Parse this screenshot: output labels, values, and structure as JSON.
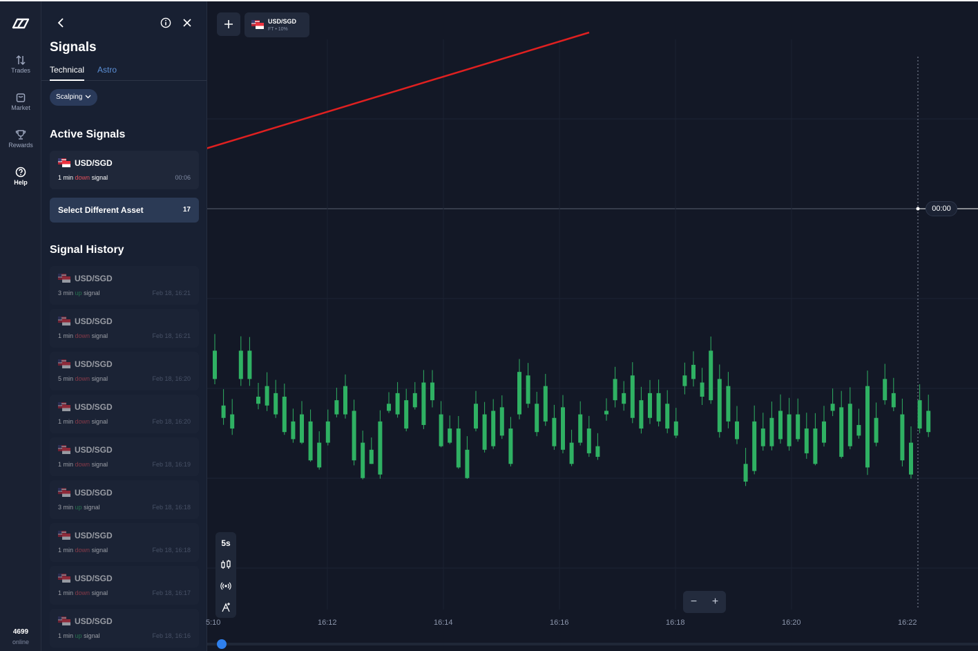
{
  "rail": {
    "items": [
      {
        "label": "Trades",
        "icon": "arrows-updown-icon"
      },
      {
        "label": "Market",
        "icon": "bag-icon"
      },
      {
        "label": "Rewards",
        "icon": "trophy-icon"
      },
      {
        "label": "Help",
        "icon": "question-icon"
      }
    ],
    "online_count": "4699",
    "online_label": "online"
  },
  "panel": {
    "title": "Signals",
    "tabs": [
      "Technical",
      "Astro"
    ],
    "filter": "Scalping",
    "active_heading": "Active Signals",
    "active_signal": {
      "symbol": "USD/SGD",
      "duration": "1 min",
      "direction": "down",
      "word": "signal",
      "timer": "00:06"
    },
    "select_button": {
      "label": "Select Different Asset",
      "count": "17"
    },
    "history_heading": "Signal History",
    "history": [
      {
        "symbol": "USD/SGD",
        "duration": "3 min",
        "direction": "up",
        "word": "signal",
        "time": "Feb 18, 16:21"
      },
      {
        "symbol": "USD/SGD",
        "duration": "1 min",
        "direction": "down",
        "word": "signal",
        "time": "Feb 18, 16:21"
      },
      {
        "symbol": "USD/SGD",
        "duration": "5 min",
        "direction": "down",
        "word": "signal",
        "time": "Feb 18, 16:20"
      },
      {
        "symbol": "USD/SGD",
        "duration": "1 min",
        "direction": "down",
        "word": "signal",
        "time": "Feb 18, 16:20"
      },
      {
        "symbol": "USD/SGD",
        "duration": "1 min",
        "direction": "down",
        "word": "signal",
        "time": "Feb 18, 16:19"
      },
      {
        "symbol": "USD/SGD",
        "duration": "3 min",
        "direction": "up",
        "word": "signal",
        "time": "Feb 18, 16:18"
      },
      {
        "symbol": "USD/SGD",
        "duration": "1 min",
        "direction": "down",
        "word": "signal",
        "time": "Feb 18, 16:18"
      },
      {
        "symbol": "USD/SGD",
        "duration": "1 min",
        "direction": "down",
        "word": "signal",
        "time": "Feb 18, 16:17"
      },
      {
        "symbol": "USD/SGD",
        "duration": "1 min",
        "direction": "up",
        "word": "signal",
        "time": "Feb 18, 16:16"
      }
    ]
  },
  "chart": {
    "asset_tab": {
      "symbol": "USD/SGD",
      "meta": "FT • 10%"
    },
    "timeframe": "5s",
    "price_tag": "00:00",
    "xticks": [
      "5:10",
      "16:12",
      "16:14",
      "16:16",
      "16:18",
      "16:20",
      "16:22"
    ],
    "colors": {
      "up": "#2fb163",
      "down": "#f05c6a",
      "annotation": "#e02020"
    }
  },
  "chart_data": {
    "type": "candlestick",
    "xlabel": "",
    "ylabel": "",
    "x": [
      "5:10",
      "16:12",
      "16:14",
      "16:16",
      "16:18",
      "16:20",
      "16:22"
    ],
    "candles": [
      [
        28,
        6,
        7.6,
        30.1,
        3.8
      ],
      [
        14,
        3.8,
        4.5,
        29.6,
        5
      ],
      [
        48,
        3.2,
        4,
        27.8,
        4.6
      ],
      [
        26,
        6,
        7.6,
        26,
        5
      ],
      [
        20,
        6,
        7.6,
        24.7,
        5
      ],
      [
        28,
        4.6,
        5,
        25,
        4
      ],
      [
        30,
        4.5,
        5.6,
        25,
        4
      ],
      [
        8,
        4,
        5.2,
        24,
        2.6
      ],
      [
        16,
        3,
        5,
        23.6,
        2
      ],
      [
        26,
        2.6,
        3.6,
        23.2,
        2.6
      ],
      [
        36,
        2.4,
        4,
        24,
        1
      ],
      [
        34,
        1.4,
        3.6,
        21.6,
        1
      ],
      [
        12,
        1,
        2.4,
        20.6,
        1.6
      ],
      [
        24,
        2.4,
        3.6,
        21.6,
        2
      ],
      [
        36,
        4,
        4.8,
        22.6,
        2.2
      ],
      [
        24,
        4,
        5.6,
        21,
        3
      ],
      [
        34,
        1.4,
        4.2,
        20.2,
        3.6
      ],
      [
        14,
        0.4,
        2.4,
        21.8,
        1
      ],
      [
        24,
        1.2,
        2,
        22.2,
        0
      ],
      [
        32,
        0.6,
        3.6,
        20.2,
        3
      ],
      [
        16,
        4.2,
        4.6,
        21,
        1.6
      ],
      [
        40,
        4,
        5.2,
        20,
        2.4
      ],
      [
        38,
        3.2,
        4.8,
        20.6,
        2
      ],
      [
        34,
        4.4,
        5.2,
        20,
        1.6
      ],
      [
        12,
        3.4,
        5.8,
        22.6,
        3
      ],
      [
        36,
        4.8,
        5.8,
        22.6,
        5.2
      ],
      [
        28,
        2.2,
        4,
        24,
        0.8
      ],
      [
        28,
        2.4,
        3.2,
        23.6,
        1
      ],
      [
        20,
        1,
        3.2,
        22.6,
        1
      ],
      [
        20,
        0.4,
        2,
        24.6,
        0.6
      ],
      [
        36,
        3.2,
        4.6,
        23.2,
        2
      ],
      [
        42,
        2,
        4,
        22.4,
        2
      ],
      [
        32,
        2.2,
        4.2,
        21.2,
        2
      ],
      [
        42,
        2.8,
        4.4,
        21.6,
        2.4
      ],
      [
        32,
        1.2,
        3.2,
        21,
        1.8
      ],
      [
        16,
        4,
        6.4,
        23.4,
        3.6
      ],
      [
        24,
        4.6,
        6.2,
        22.6,
        3
      ],
      [
        14,
        3,
        4.6,
        21.6,
        3
      ],
      [
        18,
        3.6,
        5.6,
        22,
        3.2
      ],
      [
        30,
        2.2,
        3.8,
        23.6,
        2.6
      ],
      [
        38,
        2,
        4.4,
        22.2,
        2.6
      ],
      [
        34,
        1.2,
        2.4,
        23.4,
        1.6
      ],
      [
        32,
        2.4,
        4,
        23.6,
        2
      ],
      [
        16,
        1.8,
        3.2,
        22.8,
        2.6
      ],
      [
        28,
        1.6,
        2.2,
        23.6,
        2.2
      ],
      [
        30,
        4,
        4.2,
        22.6,
        4.6
      ],
      [
        40,
        4.8,
        6,
        22,
        5.2
      ],
      [
        48,
        4.6,
        5.2,
        21.8,
        5
      ],
      [
        14,
        3.8,
        6.2,
        24,
        3.8
      ],
      [
        26,
        3.2,
        4.8,
        24.2,
        3.6
      ],
      [
        32,
        3.8,
        5.2,
        23.8,
        4.4
      ],
      [
        40,
        3.6,
        5.2,
        24.6,
        3.6
      ],
      [
        28,
        3.2,
        4.6,
        24.6,
        3.4
      ],
      [
        40,
        2.8,
        3.6,
        24.6,
        1.8
      ],
      [
        10,
        5.6,
        6.2,
        23.2,
        6
      ],
      [
        24,
        6,
        6.8,
        24.4,
        5.4
      ],
      [
        26,
        5,
        5.8,
        26.6,
        6
      ],
      [
        30,
        4.8,
        7.6,
        25.6,
        2.6
      ],
      [
        34,
        3,
        6,
        26.2,
        4
      ],
      [
        30,
        3.6,
        5.6,
        25.6,
        5
      ],
      [
        16,
        2.6,
        3.6,
        28,
        3.6
      ],
      [
        44,
        0.2,
        1.2,
        29,
        3.2
      ],
      [
        18,
        0.8,
        3.6,
        28.8,
        2.4
      ],
      [
        36,
        2.2,
        3.2,
        28.6,
        3.2
      ],
      [
        34,
        2.2,
        3.8,
        29.6,
        3
      ],
      [
        22,
        2.6,
        4.2,
        29.6,
        3.2
      ],
      [
        42,
        2.2,
        4,
        29.8,
        3.2
      ],
      [
        26,
        2.6,
        4,
        28.6,
        1.8
      ],
      [
        30,
        1.8,
        3.2,
        28.6,
        4
      ],
      [
        42,
        1.2,
        3.2,
        27.8,
        1
      ],
      [
        36,
        2.4,
        3.6,
        28.2,
        2.8
      ],
      [
        16,
        4.2,
        4.6,
        27.6,
        3.8
      ],
      [
        32,
        1.6,
        4.4,
        29.6,
        1.2
      ],
      [
        22,
        2.2,
        4.6,
        29.8,
        2.2
      ],
      [
        44,
        2.8,
        3.4,
        29.4,
        2.2
      ],
      [
        48,
        1,
        5.6,
        28,
        5.4
      ],
      [
        32,
        2.4,
        3.8,
        27.8,
        2.6
      ],
      [
        42,
        4.8,
        6,
        27.4,
        3.2
      ],
      [
        34,
        4.4,
        5.2,
        27.6,
        2.8
      ],
      [
        16,
        1.4,
        4,
        28.4,
        4.4
      ],
      [
        22,
        0.6,
        2.4,
        29.4,
        3
      ],
      [
        34,
        3.2,
        4.8,
        28.8,
        3.4
      ],
      [
        40,
        3,
        4.2,
        29.2,
        3.6
      ]
    ],
    "note": "Each candle [open_tick, open, close, high, low] in price ticks; displayed as USD/SGD 5-second candlesticks."
  }
}
